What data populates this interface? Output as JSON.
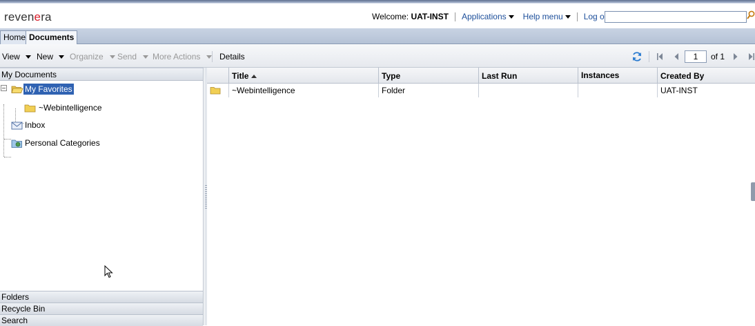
{
  "header": {
    "logo": {
      "prefix": "reven",
      "accent": "e",
      "suffix": "ra"
    },
    "welcome_label": "Welcome:",
    "username": "UAT-INST",
    "applications": "Applications",
    "help_menu": "Help menu",
    "log_off": "Log off",
    "search_value": ""
  },
  "tabs": {
    "home": "Home",
    "documents": "Documents"
  },
  "toolbar": {
    "view": "View",
    "new": "New",
    "organize": "Organize",
    "send": "Send",
    "more_actions": "More Actions",
    "details": "Details",
    "page": "1",
    "of": "of 1"
  },
  "left": {
    "title": "My Documents",
    "tree": {
      "favorites": "My Favorites",
      "webintelligence": "~Webintelligence",
      "inbox": "Inbox",
      "personal_categories": "Personal Categories"
    },
    "bottom": {
      "folders": "Folders",
      "recycle_bin": "Recycle Bin",
      "search": "Search"
    }
  },
  "grid": {
    "columns": {
      "title": "Title",
      "type": "Type",
      "last_run": "Last Run",
      "instances": "Instances",
      "created_by": "Created By"
    },
    "rows": [
      {
        "title": "~Webintelligence",
        "type": "Folder",
        "last_run": "",
        "instances": "",
        "created_by": "UAT-INST"
      }
    ]
  },
  "colors": {
    "accent": "#1c4e9a",
    "selection": "#2f62b2",
    "logo_dot": "#d81e2b"
  }
}
